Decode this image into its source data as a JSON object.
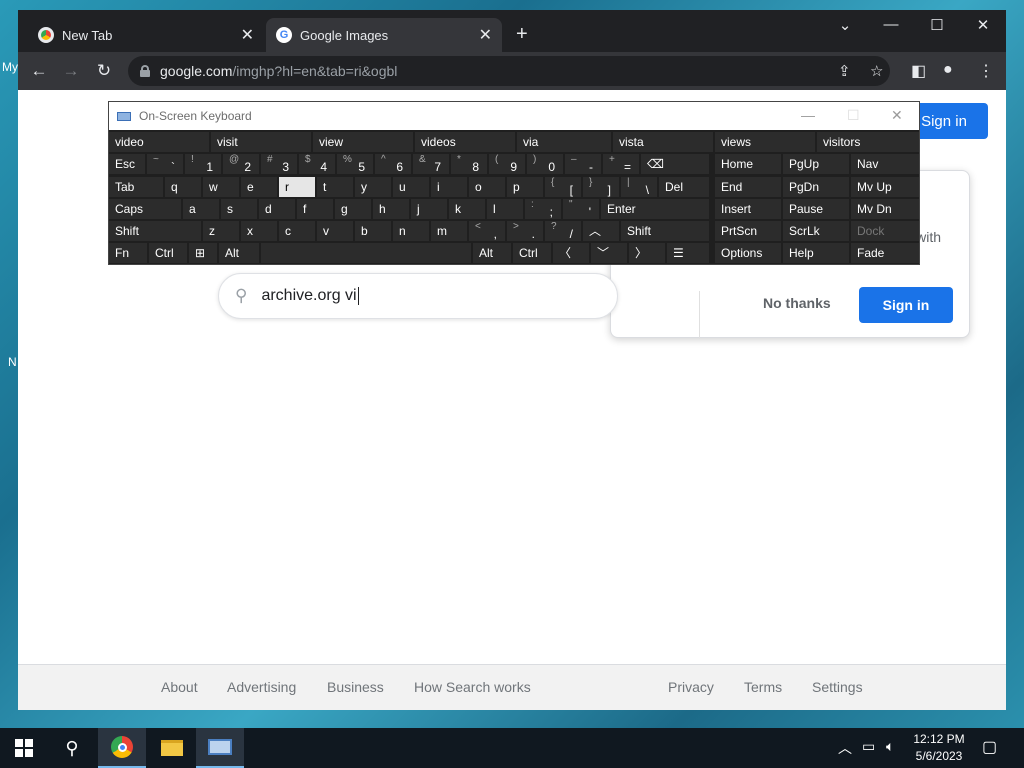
{
  "desktop": {
    "frag_my": "My",
    "frag_n": "N"
  },
  "browser": {
    "tabs": [
      {
        "label": "New Tab",
        "active": false
      },
      {
        "label": "Google Images",
        "active": true
      }
    ],
    "new_tab_glyph": "+",
    "window_controls": {
      "dropdown": "⌄",
      "minimize": "—",
      "maximize": "☐",
      "close": "✕"
    },
    "url": {
      "host": "google.com",
      "path": "/imghp?hl=en&tab=ri&ogbl"
    }
  },
  "page": {
    "signin_label": "Sign in",
    "search_value": "archive.org vi",
    "card": {
      "text_fragment": "with",
      "no_thanks": "No thanks",
      "sign_in": "Sign in"
    },
    "footer": {
      "left_links": [
        "About",
        "Advertising",
        "Business",
        "How Search works"
      ],
      "right_links": [
        "Privacy",
        "Terms",
        "Settings"
      ]
    }
  },
  "osk": {
    "title": "On-Screen Keyboard",
    "suggestions": [
      "video",
      "visit",
      "view",
      "videos",
      "via",
      "vista",
      "views",
      "visitors"
    ],
    "row1": {
      "esc": "Esc",
      "keys": [
        [
          "~",
          "`"
        ],
        [
          "!",
          "1"
        ],
        [
          "@",
          "2"
        ],
        [
          "#",
          "3"
        ],
        [
          "$",
          "4"
        ],
        [
          "%",
          "5"
        ],
        [
          "^",
          "6"
        ],
        [
          "&",
          "7"
        ],
        [
          "*",
          "8"
        ],
        [
          "(",
          "9"
        ],
        [
          ")",
          "0"
        ],
        [
          "–",
          "-"
        ],
        [
          "+",
          "="
        ]
      ],
      "backspace": "⌫"
    },
    "row2": {
      "tab": "Tab",
      "letters": [
        "q",
        "w",
        "e",
        "r",
        "t",
        "y",
        "u",
        "i",
        "o",
        "p"
      ],
      "brackets": [
        [
          "{",
          "["
        ],
        [
          "}",
          "]"
        ],
        [
          "|",
          "\\"
        ]
      ],
      "del": "Del"
    },
    "row3": {
      "caps": "Caps",
      "letters": [
        "a",
        "s",
        "d",
        "f",
        "g",
        "h",
        "j",
        "k",
        "l"
      ],
      "punct": [
        [
          ":",
          ";"
        ],
        [
          "\"",
          "'"
        ]
      ],
      "enter": "Enter"
    },
    "row4": {
      "shift": "Shift",
      "letters": [
        "z",
        "x",
        "c",
        "v",
        "b",
        "n",
        "m"
      ],
      "punct": [
        [
          "<",
          ","
        ],
        [
          ">",
          "."
        ],
        [
          "?",
          "/"
        ]
      ],
      "up": "︿",
      "shift_r": "Shift"
    },
    "row5": {
      "fn": "Fn",
      "ctrl": "Ctrl",
      "win": "⊞",
      "alt": "Alt",
      "alt_r": "Alt",
      "ctrl_r": "Ctrl",
      "left": "〈",
      "down": "﹀",
      "right": "〉",
      "menu": "☰"
    },
    "nav_block": [
      [
        "Home",
        "PgUp",
        "Nav"
      ],
      [
        "End",
        "PgDn",
        "Mv Up"
      ],
      [
        "Insert",
        "Pause",
        "Mv Dn"
      ],
      [
        "PrtScn",
        "ScrLk",
        "Dock"
      ],
      [
        "Options",
        "Help",
        "Fade"
      ]
    ],
    "highlighted_key": "r"
  },
  "taskbar": {
    "time": "12:12 PM",
    "date": "5/6/2023"
  }
}
